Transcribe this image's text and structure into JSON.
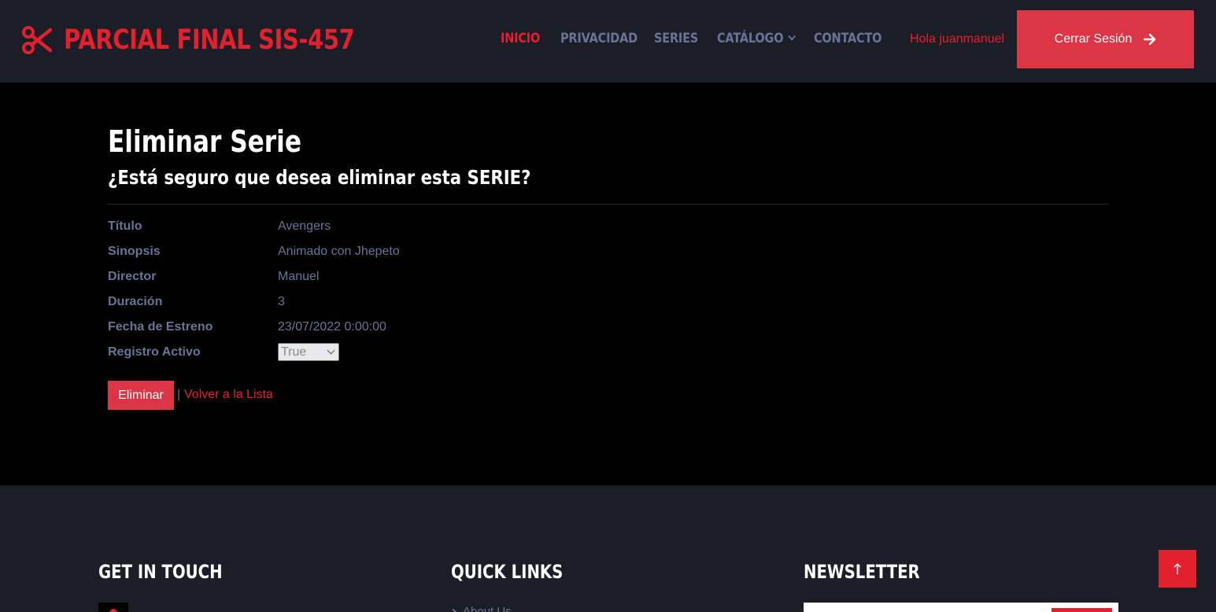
{
  "navbar": {
    "brand": "PARCIAL FINAL SIS-457",
    "brand_icon": "scissors-icon",
    "items": [
      {
        "label": "INICIO",
        "active": true
      },
      {
        "label": "PRIVACIDAD",
        "active": false
      },
      {
        "label": "SERIES",
        "active": false
      },
      {
        "label": "CATÁLOGO",
        "active": false,
        "dropdown": true
      },
      {
        "label": "CONTACTO",
        "active": false
      }
    ],
    "greeting": "Hola juanmanuel",
    "logout_label": "Cerrar Sesión",
    "logout_icon": "arrow-right-icon"
  },
  "main": {
    "title": "Eliminar Serie",
    "subtitle": "¿Está seguro que desea eliminar esta SERIE?",
    "fields": [
      {
        "label": "Título",
        "value": "Avengers"
      },
      {
        "label": "Sinopsis",
        "value": "Animado con Jhepeto"
      },
      {
        "label": "Director",
        "value": "Manuel"
      },
      {
        "label": "Duración",
        "value": "3"
      },
      {
        "label": "Fecha de Estreno",
        "value": "23/07/2022 0:00:00"
      },
      {
        "label": "Registro Activo",
        "value": "True",
        "type": "select"
      }
    ],
    "delete_label": "Eliminar",
    "separator": "|",
    "back_label": "Volver a la Lista"
  },
  "footer": {
    "get_in_touch": "GET IN TOUCH",
    "quick_links": "QUICK LINKS",
    "newsletter": "NEWSLETTER",
    "link_1": "About Us"
  },
  "colors": {
    "accent": "#e3202d",
    "button": "#dc3545",
    "nav_bg": "#1b1d27",
    "muted_text": "#6b7398"
  }
}
